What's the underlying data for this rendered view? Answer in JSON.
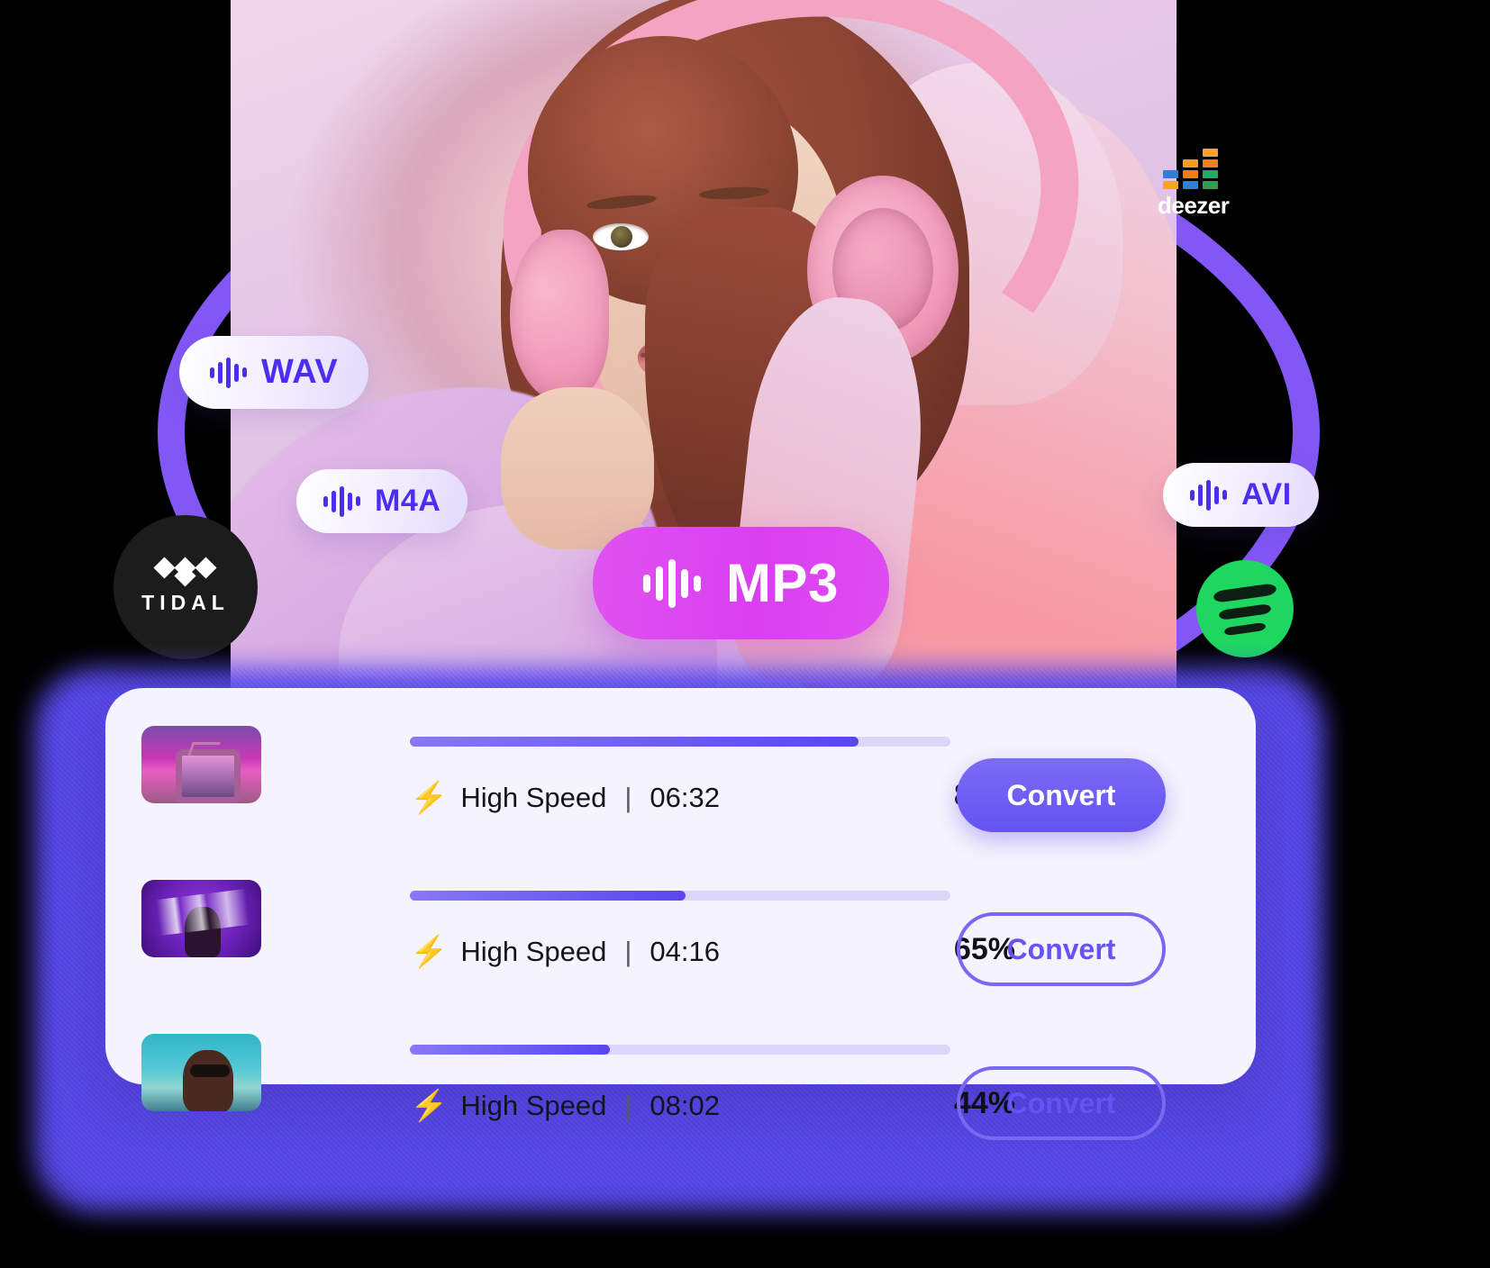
{
  "hero": {
    "alt": "woman-with-pink-headphones"
  },
  "services": [
    {
      "name": "TIDAL",
      "wordmark": "TIDAL",
      "icon": "tidal-icon",
      "color": "#1c1c1c"
    },
    {
      "name": "Spotify",
      "wordmark": "",
      "icon": "spotify-icon",
      "color": "#1ed760"
    },
    {
      "name": "Deezer",
      "wordmark": "deezer",
      "icon": "deezer-icon",
      "color": "#ffffff"
    }
  ],
  "deezer_bars": [
    "#f5a623",
    "#ef8022",
    "#2aa765",
    "#2f9e52",
    "#f79b24",
    "#ef7c21",
    "#2f7fd4",
    "#2f7fd4",
    "#f5a623",
    "#ef8022",
    "#ef8022",
    "#2f7fd4"
  ],
  "formats": {
    "wav": {
      "label": "WAV",
      "icon": "waveform-icon",
      "text_color": "#4d2ef0"
    },
    "m4a": {
      "label": "M4A",
      "icon": "waveform-icon",
      "text_color": "#4d2ef0"
    },
    "avi": {
      "label": "AVI",
      "icon": "waveform-icon",
      "text_color": "#4d2ef0"
    },
    "mp3": {
      "label": "MP3",
      "icon": "waveform-icon",
      "text_color": "#ffffff",
      "pill_color": "#d93ff0"
    }
  },
  "converter": {
    "accent": "#5a46ef",
    "panel_bg": "#f5f3fd",
    "bolt_glyph": "⚡",
    "separator": "|",
    "rows": [
      {
        "thumbnail": "retro-tv-sunset-artwork",
        "speed_label": "High Speed",
        "duration": "06:32",
        "percent_label": "80%",
        "percent_value": 83,
        "button_label": "Convert",
        "button_style": "solid"
      },
      {
        "thumbnail": "ascent-album-artwork",
        "speed_label": "High Speed",
        "duration": "04:16",
        "percent_label": "65%",
        "percent_value": 51,
        "button_label": "Convert",
        "button_style": "outline"
      },
      {
        "thumbnail": "sunglasses-portrait-artwork",
        "speed_label": "High Speed",
        "duration": "08:02",
        "percent_label": "44%",
        "percent_value": 37,
        "button_label": "Convert",
        "button_style": "outline"
      }
    ]
  }
}
